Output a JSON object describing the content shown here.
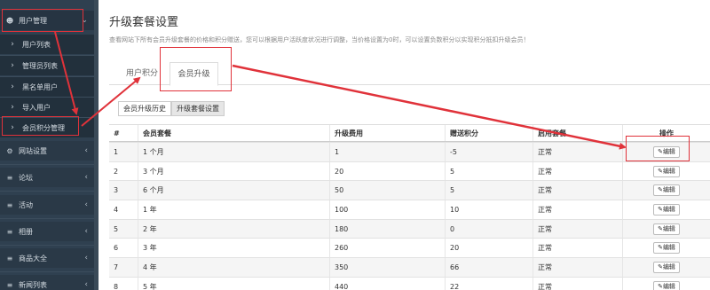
{
  "sidebar": {
    "user_mgmt": "用户管理",
    "children": [
      {
        "label": "用户列表"
      },
      {
        "label": "管理员列表"
      },
      {
        "label": "黑名单用户"
      },
      {
        "label": "导入用户"
      },
      {
        "label": "会员积分管理"
      }
    ],
    "items": [
      {
        "label": "网站设置",
        "icon": "gears-icon"
      },
      {
        "label": "论坛",
        "icon": "bars-icon"
      },
      {
        "label": "活动",
        "icon": "bars-icon"
      },
      {
        "label": "相册",
        "icon": "bars-icon"
      },
      {
        "label": "商品大全",
        "icon": "bars-icon"
      },
      {
        "label": "新闻列表",
        "icon": "bars-icon"
      }
    ]
  },
  "main": {
    "title": "升级套餐设置",
    "description": "查看网站下所有会员升级套餐的价格和积分赠送，您可以根据用户活跃度状况进行调整，当价格设置为0时，可以设置负数积分以实现积分抵扣升级会员！",
    "tabs": [
      {
        "label": "用户积分"
      },
      {
        "label": "会员升级"
      }
    ],
    "sub_buttons": [
      {
        "label": "会员升级历史"
      },
      {
        "label": "升级套餐设置"
      }
    ],
    "table": {
      "headers": [
        "#",
        "会员套餐",
        "升级费用",
        "赠送积分",
        "启用套餐",
        "操作"
      ],
      "rows": [
        {
          "no": "1",
          "plan": "1 个月",
          "fee": "1",
          "points": "-5",
          "status": "正常",
          "action": "编辑"
        },
        {
          "no": "2",
          "plan": "3 个月",
          "fee": "20",
          "points": "5",
          "status": "正常",
          "action": "编辑"
        },
        {
          "no": "3",
          "plan": "6 个月",
          "fee": "50",
          "points": "5",
          "status": "正常",
          "action": "编辑"
        },
        {
          "no": "4",
          "plan": "1 年",
          "fee": "100",
          "points": "10",
          "status": "正常",
          "action": "编辑"
        },
        {
          "no": "5",
          "plan": "2 年",
          "fee": "180",
          "points": "0",
          "status": "正常",
          "action": "编辑"
        },
        {
          "no": "6",
          "plan": "3 年",
          "fee": "260",
          "points": "20",
          "status": "正常",
          "action": "编辑"
        },
        {
          "no": "7",
          "plan": "4 年",
          "fee": "350",
          "points": "66",
          "status": "正常",
          "action": "编辑"
        },
        {
          "no": "8",
          "plan": "5 年",
          "fee": "440",
          "points": "22",
          "status": "正常",
          "action": "编辑"
        }
      ]
    }
  },
  "colors": {
    "sidebar_bg": "#2f4050",
    "annotation_red": "#e0323a",
    "row_alt": "#f5f5f5"
  }
}
